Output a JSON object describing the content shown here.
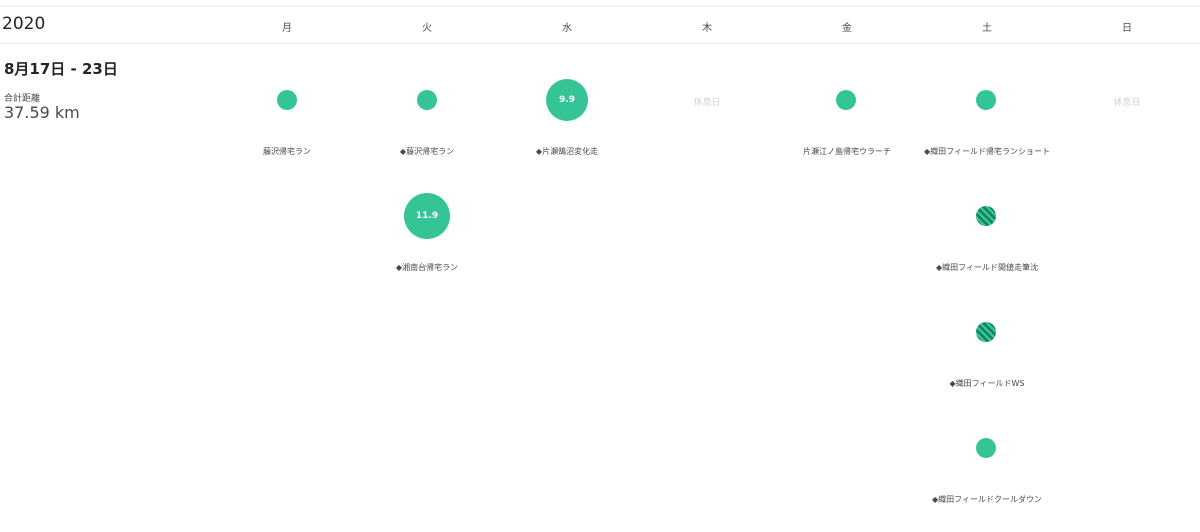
{
  "header": {
    "year": "2020",
    "days": [
      "月",
      "火",
      "水",
      "木",
      "金",
      "土",
      "日"
    ]
  },
  "week": {
    "range": "8月17日 - 23日",
    "distance_label": "合計距離",
    "distance_value": "37.59 km"
  },
  "rest_label": "休息日",
  "activities": {
    "mon_1": {
      "name": "藤沢帰宅ラン",
      "value": ""
    },
    "tue_1": {
      "name": "◆藤沢帰宅ラン",
      "value": ""
    },
    "tue_2": {
      "name": "◆湘南台帰宅ラン",
      "value": "11.9"
    },
    "wed_1": {
      "name": "◆片瀬鵠沼変化走",
      "value": "9.9"
    },
    "fri_1": {
      "name": "片瀬江ノ島帰宅ウラーチ",
      "value": ""
    },
    "sat_1": {
      "name": "◆織田フィールド帰宅ランショート",
      "value": ""
    },
    "sat_2": {
      "name": "◆織田フィールド間値走筆沈",
      "value": ""
    },
    "sat_3": {
      "name": "◆織田フィールドWS",
      "value": ""
    },
    "sat_4": {
      "name": "◆織田フィールドクールダウン",
      "value": ""
    }
  },
  "colors": {
    "accent": "#34c496",
    "accent_dark": "#17805f",
    "text": "#242428",
    "muted": "#494950",
    "rest": "#d0d0d4"
  }
}
